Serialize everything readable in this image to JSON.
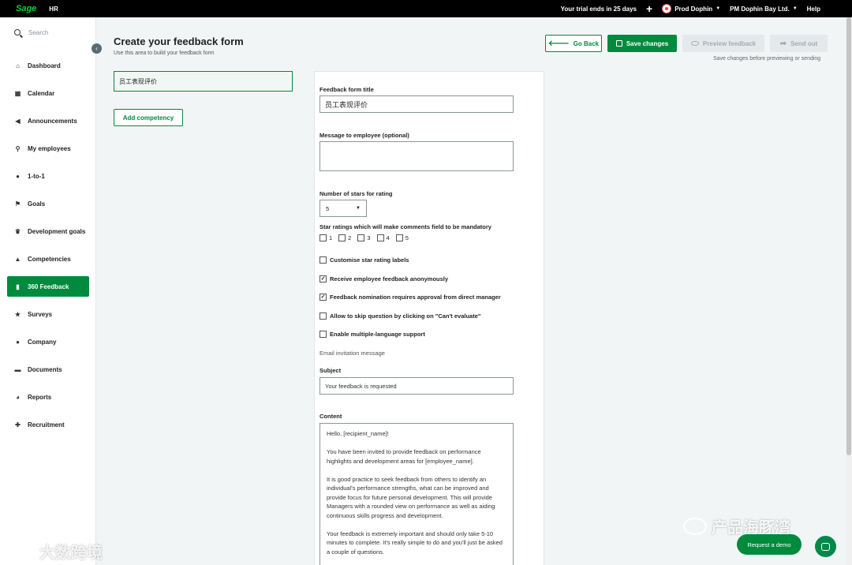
{
  "topbar": {
    "logo": "Sage",
    "product": "HR",
    "trial": "Your trial ends in 25 days",
    "plus": "+",
    "user": "Prod Dophin",
    "company": "PM Dophin Bay Ltd.",
    "help": "Help"
  },
  "sidebar": {
    "search_placeholder": "Search",
    "items": [
      {
        "label": "Dashboard",
        "icon": "home-icon"
      },
      {
        "label": "Calendar",
        "icon": "calendar-icon"
      },
      {
        "label": "Announcements",
        "icon": "megaphone-icon"
      },
      {
        "label": "My employees",
        "icon": "org-chart-icon"
      },
      {
        "label": "1-to-1",
        "icon": "chat-icon"
      },
      {
        "label": "Goals",
        "icon": "flag-icon"
      },
      {
        "label": "Development goals",
        "icon": "trophy-icon"
      },
      {
        "label": "Competencies",
        "icon": "graduation-cap-icon"
      },
      {
        "label": "360 Feedback",
        "icon": "document-icon"
      },
      {
        "label": "Surveys",
        "icon": "star-icon"
      },
      {
        "label": "Company",
        "icon": "people-icon"
      },
      {
        "label": "Documents",
        "icon": "folder-icon"
      },
      {
        "label": "Reports",
        "icon": "pie-chart-icon"
      },
      {
        "label": "Recruitment",
        "icon": "add-user-icon"
      }
    ],
    "active_index": 8
  },
  "header": {
    "title": "Create your feedback form",
    "subtitle": "Use this area to build your feedback form",
    "go_back": "Go Back",
    "save": "Save changes",
    "preview": "Preview feedback",
    "send": "Send out",
    "save_note": "Save changes before previewing or sending"
  },
  "left": {
    "competency_value": "员工表现评价",
    "add_competency": "Add competency"
  },
  "form": {
    "title_label": "Feedback form title",
    "title_value": "员工表现评价",
    "message_label": "Message to employee (optional)",
    "message_value": "",
    "stars_label": "Number of stars for rating",
    "stars_value": "5",
    "mandatory_label": "Star ratings which will make comments field to be mandatory",
    "mandatory_options": [
      "1",
      "2",
      "3",
      "4",
      "5"
    ],
    "checks": [
      {
        "label": "Customise star rating labels",
        "checked": false
      },
      {
        "label": "Receive employee feedback anonymously",
        "checked": true
      },
      {
        "label": "Feedback nomination requires approval from direct manager",
        "checked": true
      },
      {
        "label": "Allow to skip question by clicking on \"Can't evaluate\"",
        "checked": false
      },
      {
        "label": "Enable multiple-language support",
        "checked": false
      }
    ],
    "email_invitation": "Email invitation message",
    "subject_label": "Subject",
    "subject_value": "Your feedback is requested",
    "content_label": "Content",
    "content_paragraphs": [
      "Hello, [recipient_name]!",
      "You have been invited to provide feedback on performance highlights and development areas for [employee_name].",
      "It is good practice to seek feedback from others to identify an individual's performance strengths, what can be improved and provide focus for future personal development. This will provide Managers with a rounded view on performance as well as aiding continuous skills progress and development.",
      "Your feedback is extremely important and should only take 5-10 minutes to complete. It's really simple to do and you'll just be asked a couple of questions."
    ]
  },
  "footer": {
    "request_demo": "Request a demo"
  },
  "watermarks": {
    "left": "大数跨境",
    "right": "产品海豚湾"
  },
  "colors": {
    "brand_green": "#008a3e",
    "logo_green": "#00d639",
    "topbar": "#000000"
  }
}
